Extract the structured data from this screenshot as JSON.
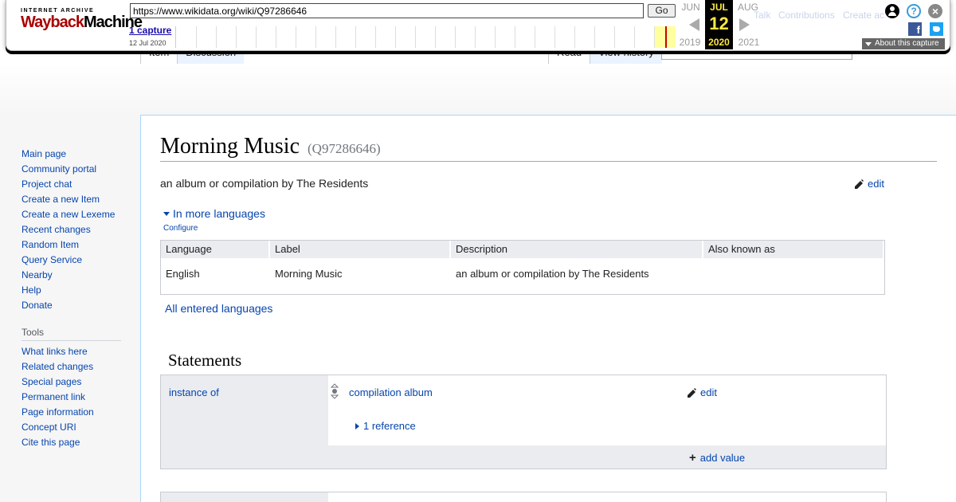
{
  "wayback": {
    "logo_top": "INTERNET ARCHIVE",
    "logo_word1": "Wayback",
    "logo_word2": "Machine",
    "url": "https://www.wikidata.org/wiki/Q97286646",
    "go_label": "Go",
    "captures_label": "1 capture",
    "capture_date": "12 Jul 2020",
    "prev_month": "JUN",
    "current_month": "JUL",
    "next_month": "AUG",
    "current_day": "12",
    "prev_year": "2019",
    "current_year": "2020",
    "next_year": "2021",
    "about_label": "About this capture",
    "ghost_links": [
      "Talk",
      "Contributions",
      "Create ac"
    ],
    "colors": {
      "highlight": "#ffe840",
      "logo_red": "#aa0000"
    }
  },
  "tabs": {
    "item": "Item",
    "discussion": "Discussion",
    "read": "Read",
    "view_history": "View history"
  },
  "sidebar": {
    "navigation": [
      "Main page",
      "Community portal",
      "Project chat",
      "Create a new Item",
      "Create a new Lexeme",
      "Recent changes",
      "Random Item",
      "Query Service",
      "Nearby",
      "Help",
      "Donate"
    ],
    "tools_heading": "Tools",
    "tools": [
      "What links here",
      "Related changes",
      "Special pages",
      "Permanent link",
      "Page information",
      "Concept URI",
      "Cite this page"
    ]
  },
  "item": {
    "title": "Morning Music",
    "qid": "(Q97286646)",
    "description": "an album or compilation by The Residents",
    "edit_label": "edit",
    "more_languages": "In more languages",
    "configure": "Configure",
    "lang_table": {
      "headers": [
        "Language",
        "Label",
        "Description",
        "Also known as"
      ],
      "rows": [
        [
          "English",
          "Morning Music",
          "an album or compilation by The Residents",
          ""
        ]
      ]
    },
    "all_languages": "All entered languages"
  },
  "statements": {
    "heading": "Statements",
    "list": [
      {
        "property": "instance of",
        "value": "compilation album",
        "edit_label": "edit",
        "references": "1 reference",
        "add_value": "add value"
      }
    ]
  }
}
